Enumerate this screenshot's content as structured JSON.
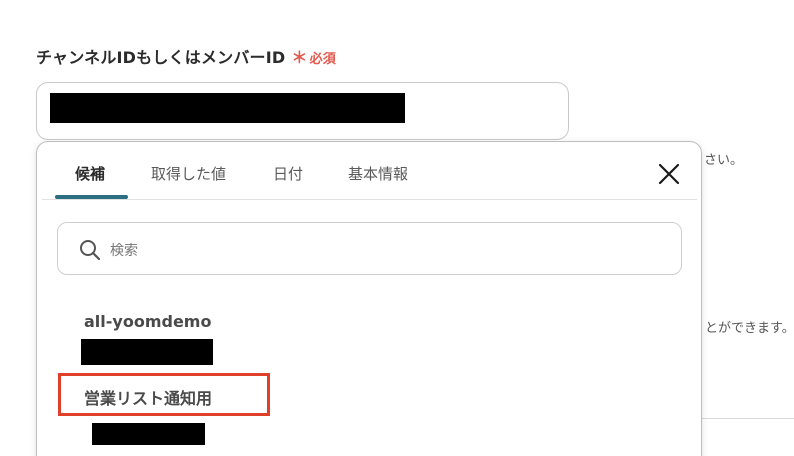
{
  "field": {
    "label": "チャンネルIDもしくはメンバーID",
    "required_star": "＊",
    "required_text": "必須",
    "value": ""
  },
  "background_hints": {
    "hint_top": "さい。",
    "hint_bottom": "とができます。"
  },
  "popup": {
    "tabs": [
      {
        "label": "候補",
        "active": true
      },
      {
        "label": "取得した値",
        "active": false
      },
      {
        "label": "日付",
        "active": false
      },
      {
        "label": "基本情報",
        "active": false
      }
    ],
    "search": {
      "placeholder": "検索"
    },
    "options": [
      {
        "title": "all-yoomdemo",
        "subtitle": ""
      },
      {
        "title": "営業リスト通知用",
        "subtitle": ""
      }
    ]
  },
  "colors": {
    "accent": "#2b6f82",
    "required": "#e05a4f",
    "highlight": "#e0402a"
  },
  "icons": [
    "close-icon",
    "search-icon"
  ]
}
